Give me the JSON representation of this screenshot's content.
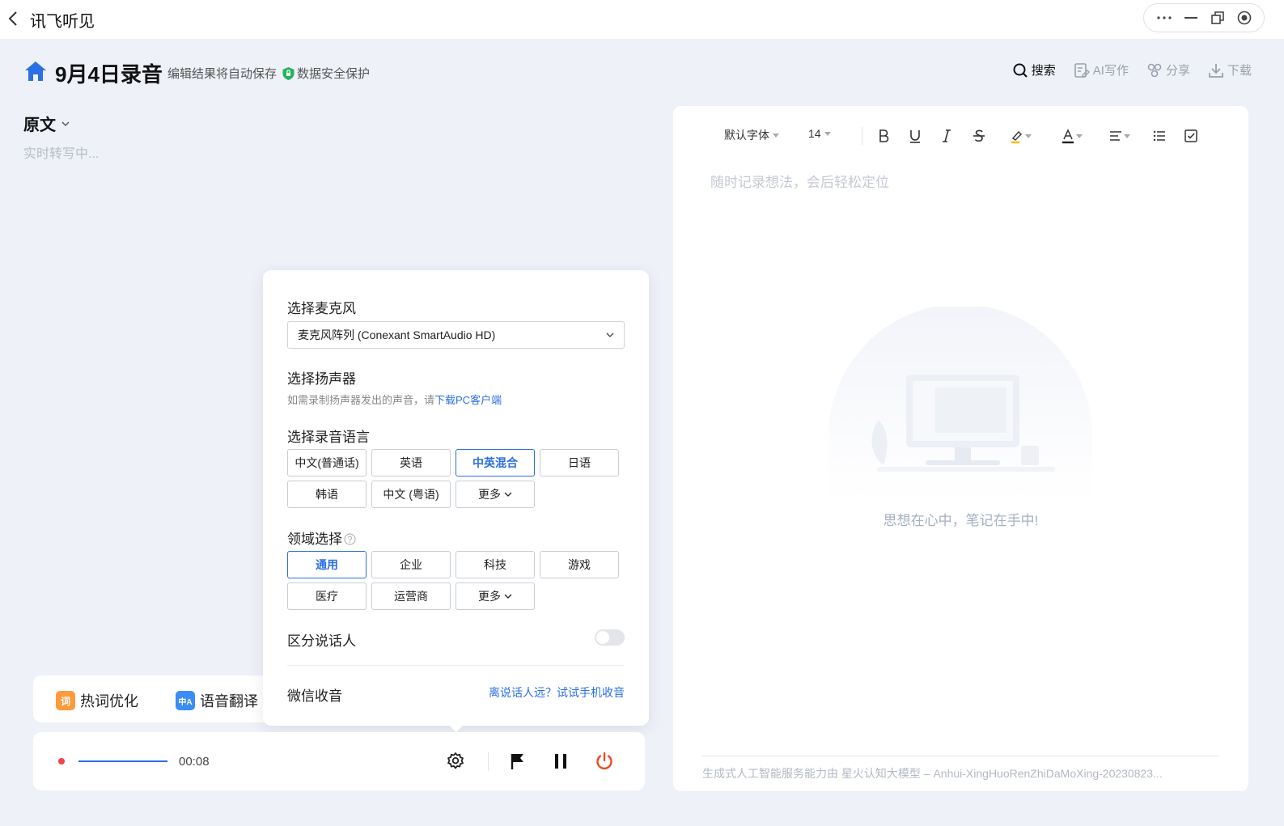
{
  "app": {
    "title": "讯飞听见"
  },
  "header": {
    "doc_title": "9月4日录音",
    "autosave": "编辑结果将自动保存",
    "secure": "数据安全保护",
    "actions": [
      {
        "label": "搜索",
        "icon": "search-icon",
        "active": true
      },
      {
        "label": "AI写作",
        "icon": "ai-write-icon",
        "active": false
      },
      {
        "label": "分享",
        "icon": "share-icon",
        "active": false
      },
      {
        "label": "下载",
        "icon": "download-icon",
        "active": false
      }
    ]
  },
  "left": {
    "view_label": "原文",
    "status": "实时转写中..."
  },
  "popup": {
    "mic_label": "选择麦克风",
    "mic_value": "麦克风阵列 (Conexant SmartAudio HD)",
    "speaker_label": "选择扬声器",
    "speaker_hint": "如需录制扬声器发出的声音，请",
    "speaker_link": "下载PC客户端",
    "lang_label": "选择录音语言",
    "languages": [
      "中文(普通话)",
      "英语",
      "中英混合",
      "日语",
      "韩语",
      "中文 (粤语)",
      "更多"
    ],
    "lang_selected": "中英混合",
    "domain_label": "领域选择",
    "domains": [
      "通用",
      "企业",
      "科技",
      "游戏",
      "医疗",
      "运营商",
      "更多"
    ],
    "domain_selected": "通用",
    "speaker_sep_label": "区分说话人",
    "speaker_sep_on": false,
    "wechat_label": "微信收音",
    "wechat_link": "离说话人远？试试手机收音"
  },
  "features": {
    "hotword": "热词优化",
    "hotword_icon_text": "词",
    "translate": "语音翻译",
    "translate_icon_text": "中A"
  },
  "recorder": {
    "time": "00:08"
  },
  "editor": {
    "font": "默认字体",
    "size": "14",
    "placeholder": "随时记录想法，会后轻松定位",
    "empty_text": "思想在心中，笔记在手中!",
    "footer": "生成式人工智能服务能力由 星火认知大模型 – Anhui-XingHuoRenZhiDaMoXing-20230823..."
  },
  "colors": {
    "accent": "#2b6fe5",
    "record": "#f0434c",
    "power": "#f04a24",
    "background": "#eef1f8"
  }
}
